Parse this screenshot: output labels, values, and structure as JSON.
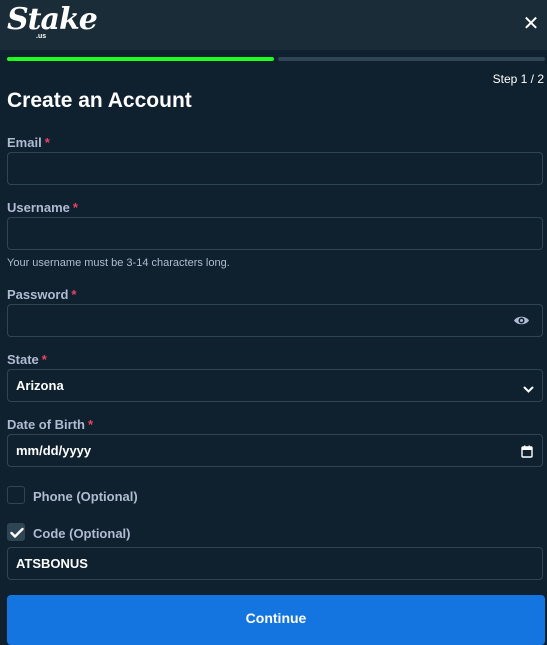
{
  "header": {
    "logo": "Stake",
    "logo_sub": ".us",
    "close_glyph": "✕"
  },
  "progress": {
    "step_text": "Step 1 / 2",
    "completed_fraction": 0.5,
    "fill_color": "#1fff20"
  },
  "title": "Create an Account",
  "form": {
    "email": {
      "label": "Email",
      "required": "*",
      "value": ""
    },
    "username": {
      "label": "Username",
      "required": "*",
      "value": "",
      "hint": "Your username must be 3-14 characters long."
    },
    "password": {
      "label": "Password",
      "required": "*",
      "value": "",
      "icon": "eye-icon"
    },
    "state": {
      "label": "State",
      "required": "*",
      "value": "Arizona",
      "icon": "chevron-down-icon"
    },
    "dob": {
      "label": "Date of Birth",
      "required": "*",
      "value": "mm/dd/yyyy",
      "icon": "calendar-icon"
    },
    "phone": {
      "label": "Phone (Optional)",
      "checked": false
    },
    "code": {
      "label": "Code (Optional)",
      "checked": true,
      "value": "ATSBONUS"
    }
  },
  "continue_label": "Continue",
  "colors": {
    "background": "#0f212e",
    "header": "#1a2c38",
    "border": "#2f4553",
    "label": "#b1bad3",
    "required": "#ed4163",
    "button": "#1475e1"
  }
}
